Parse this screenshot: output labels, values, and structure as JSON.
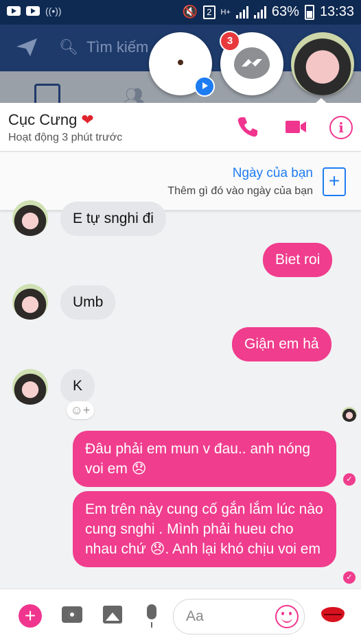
{
  "status_bar": {
    "battery": "63%",
    "time": "13:33",
    "sim_slot": "2",
    "network": "H+"
  },
  "app_bar": {
    "search_placeholder": "Tìm kiếm"
  },
  "chat_heads": {
    "unread_badge": "3"
  },
  "contact": {
    "name": "Cục Cưng",
    "status": "Hoạt động 3 phút trước"
  },
  "day_card": {
    "title": "Ngày của bạn",
    "subtitle": "Thêm gì đó vào ngày của bạn"
  },
  "messages": [
    {
      "from": "them",
      "text": "E tự snghi đi"
    },
    {
      "from": "me",
      "text": "Biet roi"
    },
    {
      "from": "them",
      "text": "Umb"
    },
    {
      "from": "me",
      "text": "Giận em hả"
    },
    {
      "from": "them",
      "text": "K"
    },
    {
      "from": "me",
      "text": "Đâu phải em mun v đau.. anh nóng voi em 😞"
    },
    {
      "from": "me",
      "text": "Em trên này cung cố gắn lắm lúc nào cung snghi . Mình phải hueu cho nhau chứ 😞. Anh lại khó chịu voi em"
    }
  ],
  "composer": {
    "placeholder": "Aa"
  },
  "colors": {
    "accent": "#f03d8d",
    "link": "#1e7cf2",
    "header": "#0f2a52"
  }
}
